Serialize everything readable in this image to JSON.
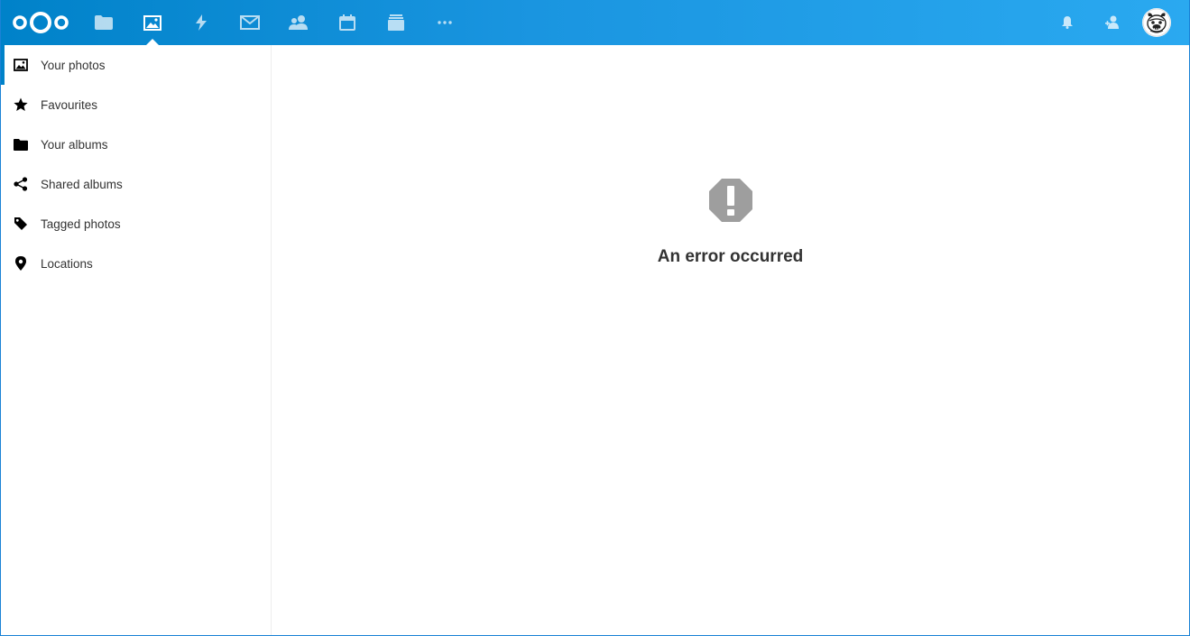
{
  "header": {
    "logo_icon": "nextcloud-logo",
    "apps": [
      {
        "name": "files",
        "icon": "folder-icon",
        "active": false
      },
      {
        "name": "photos",
        "icon": "image-icon",
        "active": true
      },
      {
        "name": "activity",
        "icon": "lightning-icon",
        "active": false
      },
      {
        "name": "mail",
        "icon": "mail-icon",
        "active": false
      },
      {
        "name": "contacts",
        "icon": "contacts-icon",
        "active": false
      },
      {
        "name": "calendar",
        "icon": "calendar-icon",
        "active": false
      },
      {
        "name": "deck",
        "icon": "deck-icon",
        "active": false
      },
      {
        "name": "more",
        "icon": "more-icon",
        "active": false
      }
    ],
    "right_icons": [
      "bell-icon",
      "contacts-menu-icon"
    ],
    "avatar_icon": "user-avatar",
    "colors": {
      "gradient_start": "#0082c9",
      "gradient_end": "#2aa9f0"
    }
  },
  "sidebar": {
    "items": [
      {
        "label": "Your photos",
        "icon": "image-icon",
        "active": true
      },
      {
        "label": "Favourites",
        "icon": "star-icon",
        "active": false
      },
      {
        "label": "Your albums",
        "icon": "folder-icon",
        "active": false
      },
      {
        "label": "Shared albums",
        "icon": "share-icon",
        "active": false
      },
      {
        "label": "Tagged photos",
        "icon": "tag-icon",
        "active": false
      },
      {
        "label": "Locations",
        "icon": "location-pin-icon",
        "active": false
      }
    ]
  },
  "main": {
    "error_icon": "error-octagon-icon",
    "error_title": "An error occurred"
  }
}
